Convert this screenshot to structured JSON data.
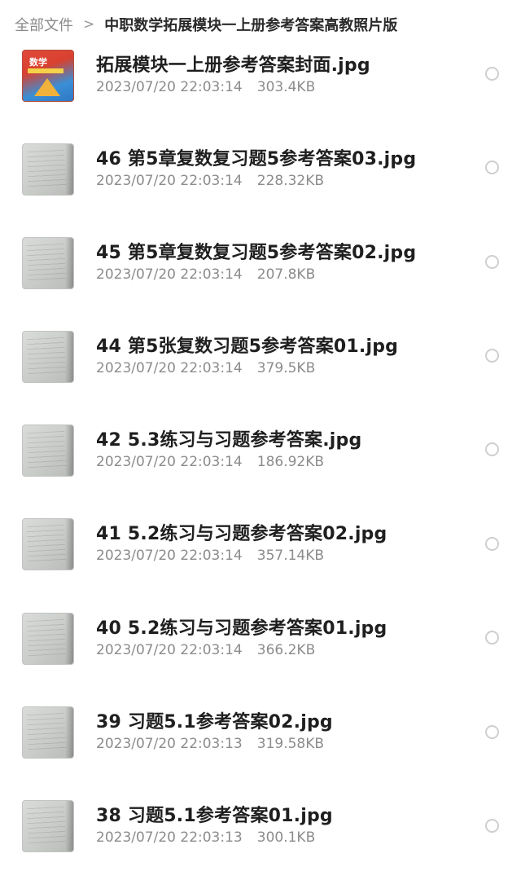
{
  "breadcrumb": {
    "root": "全部文件",
    "separator": ">",
    "current": "中职数学拓展模块一上册参考答案高教照片版"
  },
  "files": [
    {
      "name": "拓展模块一上册参考答案封面.jpg",
      "datetime": "2023/07/20 22:03:14",
      "size": "303.4KB",
      "thumb": "cover",
      "cover_text": "数学"
    },
    {
      "name": "46 第5章复数复习题5参考答案03.jpg",
      "datetime": "2023/07/20 22:03:14",
      "size": "228.32KB",
      "thumb": "photo"
    },
    {
      "name": "45 第5章复数复习题5参考答案02.jpg",
      "datetime": "2023/07/20 22:03:14",
      "size": "207.8KB",
      "thumb": "photo"
    },
    {
      "name": "44 第5张复数习题5参考答案01.jpg",
      "datetime": "2023/07/20 22:03:14",
      "size": "379.5KB",
      "thumb": "photo"
    },
    {
      "name": "42 5.3练习与习题参考答案.jpg",
      "datetime": "2023/07/20 22:03:14",
      "size": "186.92KB",
      "thumb": "photo"
    },
    {
      "name": "41 5.2练习与习题参考答案02.jpg",
      "datetime": "2023/07/20 22:03:14",
      "size": "357.14KB",
      "thumb": "photo"
    },
    {
      "name": "40 5.2练习与习题参考答案01.jpg",
      "datetime": "2023/07/20 22:03:14",
      "size": "366.2KB",
      "thumb": "photo"
    },
    {
      "name": "39 习题5.1参考答案02.jpg",
      "datetime": "2023/07/20 22:03:13",
      "size": "319.58KB",
      "thumb": "photo"
    },
    {
      "name": "38 习题5.1参考答案01.jpg",
      "datetime": "2023/07/20 22:03:13",
      "size": "300.1KB",
      "thumb": "photo"
    }
  ]
}
